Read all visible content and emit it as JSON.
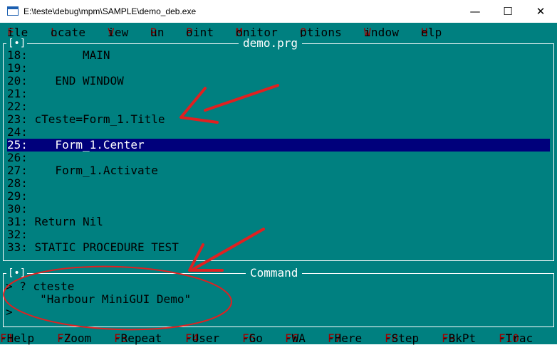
{
  "window": {
    "title": "E:\\teste\\debug\\mpm\\SAMPLE\\demo_deb.exe",
    "minimize_glyph": "—",
    "maximize_glyph": "☐",
    "close_glyph": "✕"
  },
  "menu": [
    {
      "hot": "F",
      "rest": "ile"
    },
    {
      "hot": "L",
      "rest": "ocate"
    },
    {
      "hot": "V",
      "rest": "iew"
    },
    {
      "hot": "R",
      "rest": "un"
    },
    {
      "hot": "P",
      "rest": "oint"
    },
    {
      "hot": "M",
      "rest": "onitor"
    },
    {
      "hot": "O",
      "rest": "ptions"
    },
    {
      "hot": "W",
      "rest": "indow"
    },
    {
      "hot": "H",
      "rest": "elp"
    }
  ],
  "code_window": {
    "title": "demo.prg",
    "button": "[•]",
    "lines": [
      "18:        MAIN",
      "19:",
      "20:    END WINDOW",
      "21:",
      "22:",
      "23: cTeste=Form_1.Title",
      "24:",
      "25:    Form_1.Center",
      "26:",
      "27:    Form_1.Activate",
      "28:",
      "29:",
      "30:",
      "31: Return Nil",
      "32:",
      "33: STATIC PROCEDURE TEST"
    ],
    "current_line_index": 7
  },
  "command_window": {
    "title": "Command",
    "button": "[•]",
    "lines": [
      "> ? cteste",
      "     \"Harbour MiniGUI Demo\"",
      ">"
    ]
  },
  "fkeys": [
    {
      "key": "F1",
      "label": "-Help"
    },
    {
      "key": "F2",
      "label": "-Zoom"
    },
    {
      "key": "F3",
      "label": "-Repeat"
    },
    {
      "key": "F4",
      "label": "-User"
    },
    {
      "key": "F5",
      "label": "-Go"
    },
    {
      "key": "F6",
      "label": "-WA"
    },
    {
      "key": "F7",
      "label": "-Here"
    },
    {
      "key": "F8",
      "label": "-Step"
    },
    {
      "key": "F9",
      "label": "-BkPt"
    },
    {
      "key": "F10",
      "label": "-Trac"
    }
  ],
  "colors": {
    "console_bg": "#008080",
    "highlight_bg": "#00007b",
    "hotkey": "#a00000",
    "annotation": "#e02020"
  }
}
